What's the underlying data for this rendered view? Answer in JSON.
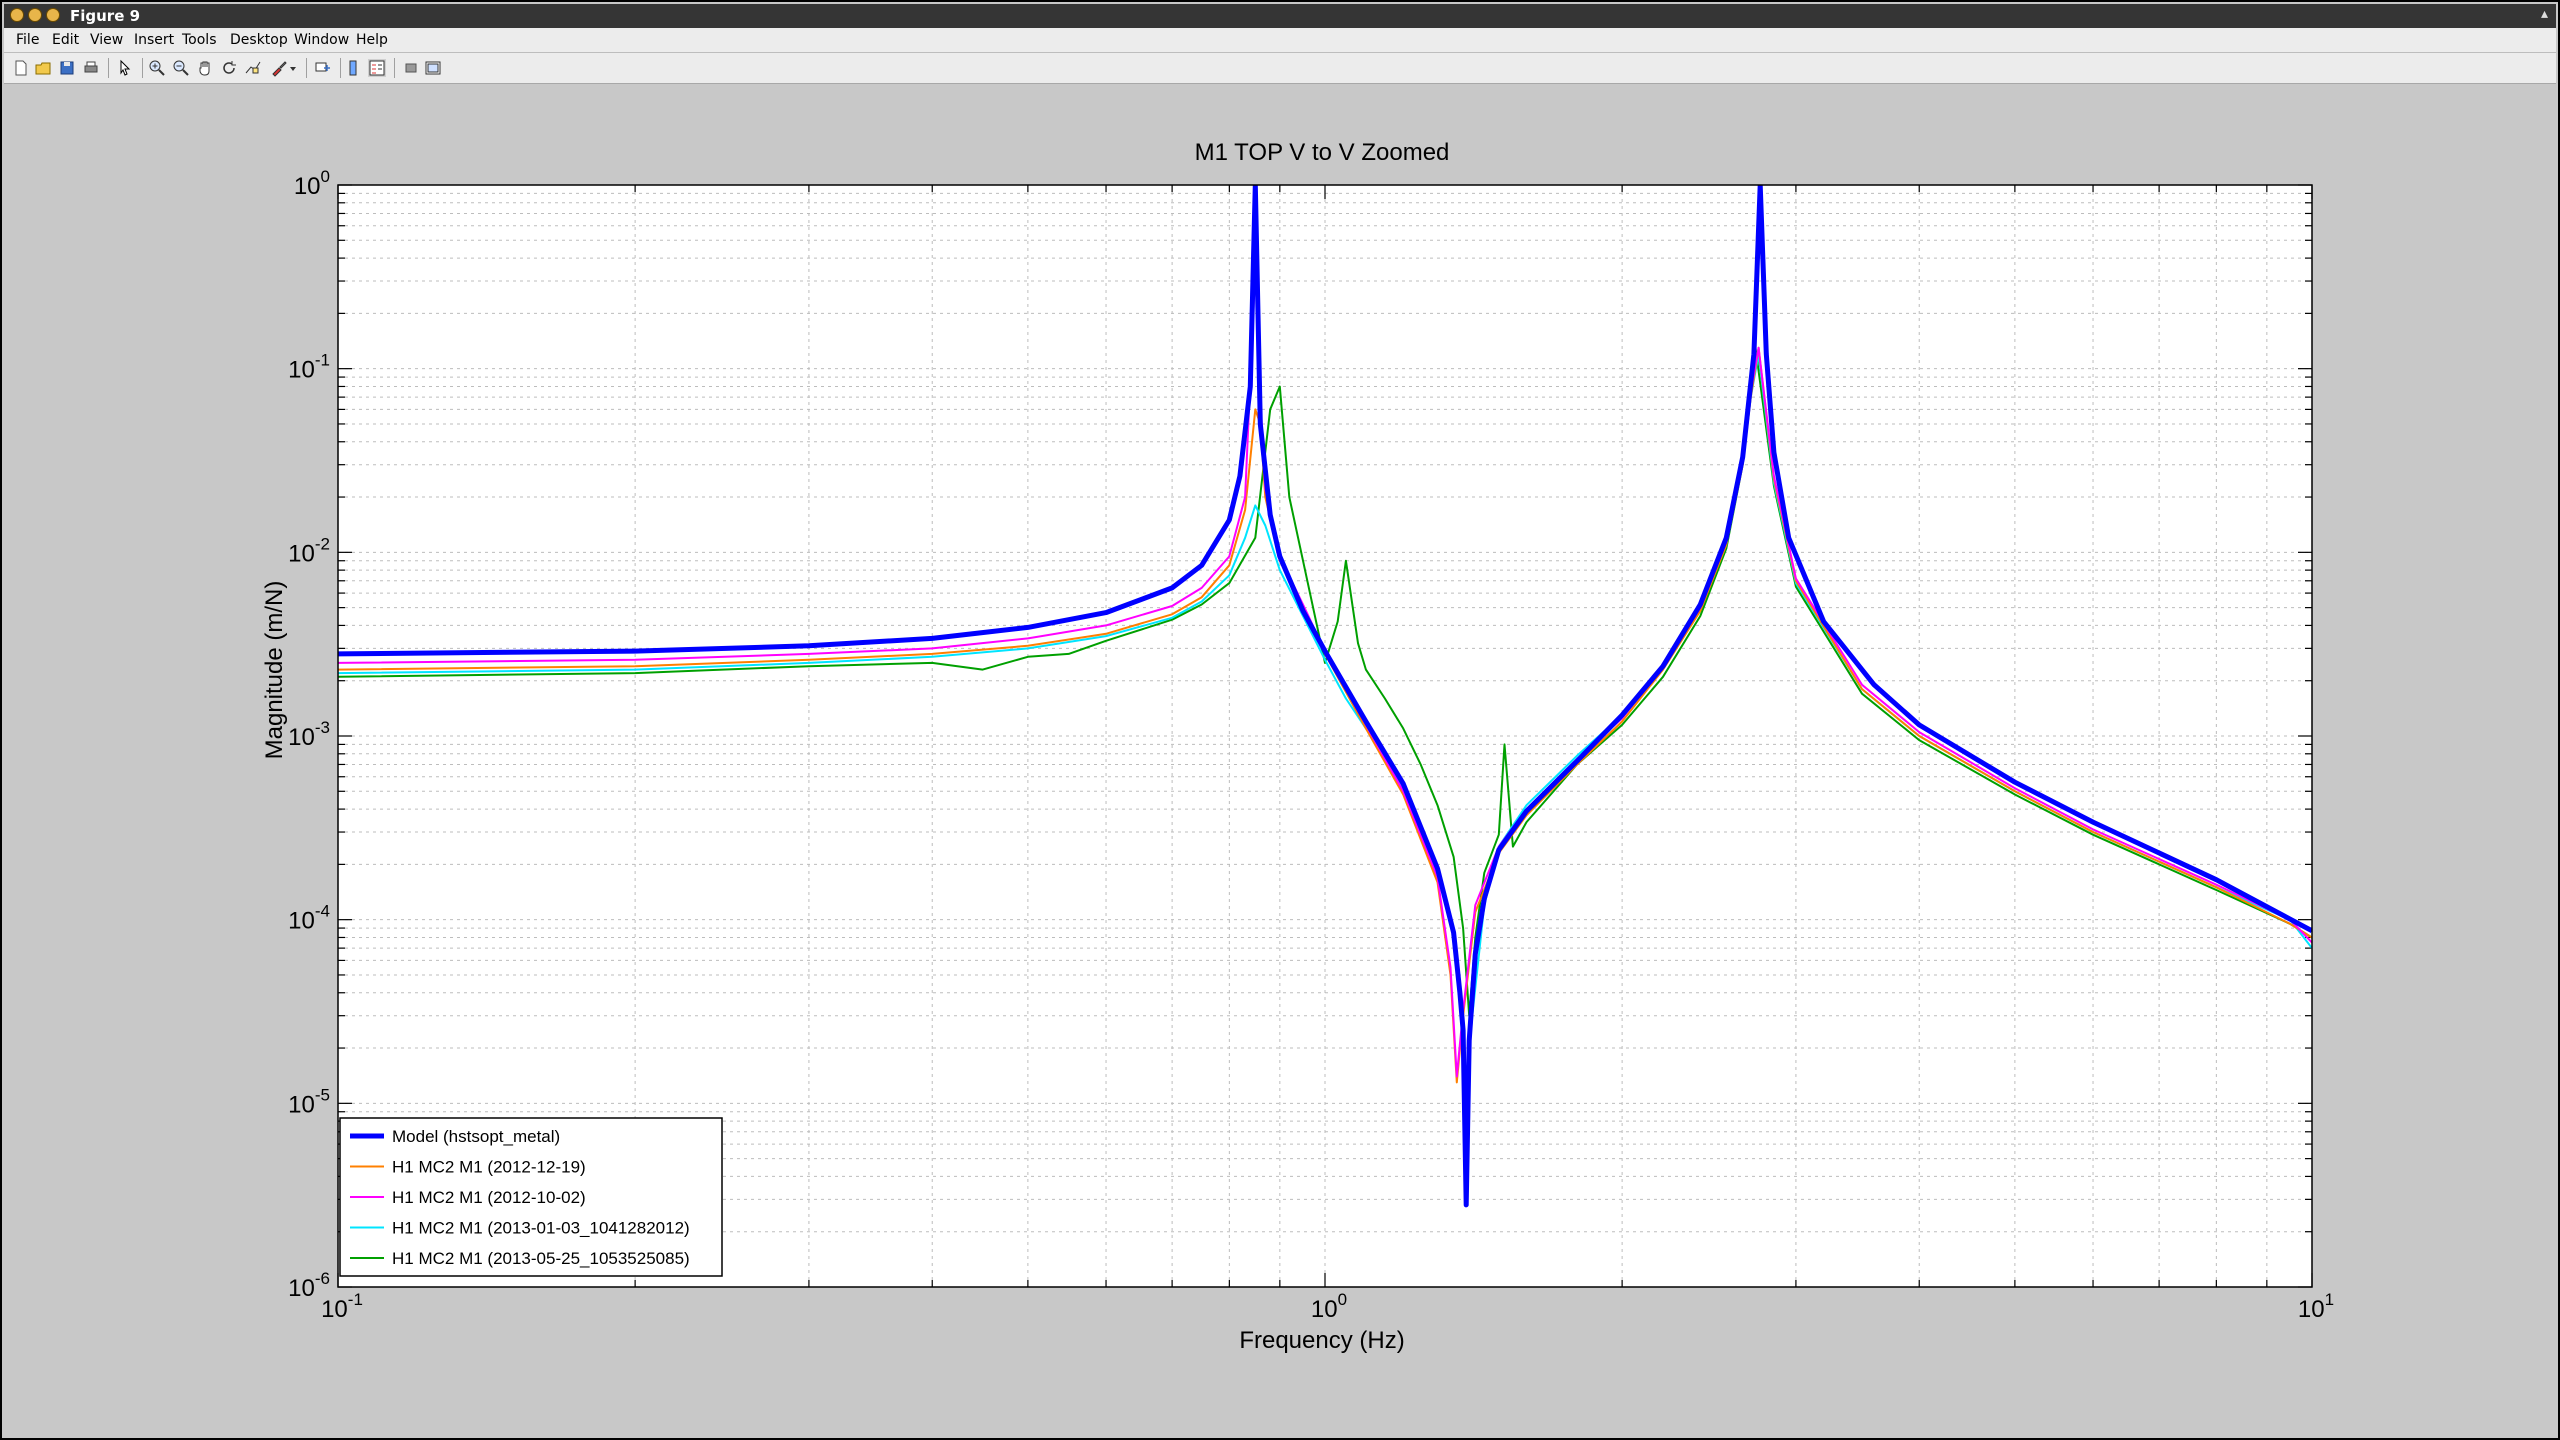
{
  "window": {
    "title": "Figure 9"
  },
  "menu": [
    "File",
    "Edit",
    "View",
    "Insert",
    "Tools",
    "Desktop",
    "Window",
    "Help"
  ],
  "toolbar": [
    "new-figure-icon",
    "open-file-icon",
    "save-icon",
    "print-icon",
    "edit-plot-arrow-icon",
    "zoom-in-icon",
    "zoom-out-icon",
    "pan-hand-icon",
    "rotate-3d-icon",
    "data-cursor-icon",
    "brush-icon",
    "brush-dropdown-icon",
    "link-plot-icon",
    "colorbar-icon",
    "legend-icon",
    "hide-plot-tools-icon",
    "show-plot-tools-icon"
  ],
  "chart_data": {
    "type": "line",
    "title": "M1 TOP V to V Zoomed",
    "xlabel": "Frequency (Hz)",
    "ylabel": "Magnitude (m/N)",
    "xscale": "log",
    "yscale": "log",
    "xlim": [
      0.1,
      10
    ],
    "ylim": [
      1e-06,
      1
    ],
    "grid": true,
    "legend_position": "bottom-left",
    "x_ticks": [
      {
        "base": "10",
        "exp": "-1"
      },
      {
        "base": "10",
        "exp": "0"
      },
      {
        "base": "10",
        "exp": "1"
      }
    ],
    "y_ticks": [
      {
        "base": "10",
        "exp": "-6"
      },
      {
        "base": "10",
        "exp": "-5"
      },
      {
        "base": "10",
        "exp": "-4"
      },
      {
        "base": "10",
        "exp": "-3"
      },
      {
        "base": "10",
        "exp": "-2"
      },
      {
        "base": "10",
        "exp": "-1"
      },
      {
        "base": "10",
        "exp": "0"
      }
    ],
    "series": [
      {
        "name": "Model (hstsopt_metal)",
        "color": "#0000ff",
        "x": [
          0.1,
          0.2,
          0.3,
          0.4,
          0.5,
          0.6,
          0.7,
          0.75,
          0.8,
          0.82,
          0.84,
          0.85,
          0.86,
          0.88,
          0.9,
          0.95,
          1.0,
          1.1,
          1.2,
          1.3,
          1.35,
          1.37,
          1.38,
          1.39,
          1.4,
          1.42,
          1.45,
          1.5,
          1.6,
          1.8,
          2.0,
          2.2,
          2.4,
          2.55,
          2.65,
          2.72,
          2.76,
          2.8,
          2.85,
          2.95,
          3.2,
          3.6,
          4.0,
          5.0,
          6.0,
          8.0,
          10.0
        ],
        "y": [
          0.0028,
          0.0029,
          0.0031,
          0.0034,
          0.0039,
          0.0047,
          0.0064,
          0.0085,
          0.015,
          0.026,
          0.08,
          1.0,
          0.05,
          0.016,
          0.0095,
          0.0048,
          0.0029,
          0.0012,
          0.00055,
          0.00019,
          8.5e-05,
          4e-05,
          2.5e-05,
          2.8e-06,
          2.2e-05,
          6.5e-05,
          0.00013,
          0.00024,
          0.00039,
          0.00073,
          0.0013,
          0.0024,
          0.0052,
          0.012,
          0.033,
          0.12,
          1.0,
          0.12,
          0.035,
          0.012,
          0.0042,
          0.0019,
          0.00115,
          0.00056,
          0.00034,
          0.000165,
          8.7e-05
        ]
      },
      {
        "name": "H1 MC2  M1 (2012-12-19)",
        "color": "#ff8000",
        "x": [
          0.1,
          0.2,
          0.3,
          0.4,
          0.5,
          0.6,
          0.7,
          0.75,
          0.8,
          0.83,
          0.85,
          0.86,
          0.87,
          0.9,
          0.95,
          1.0,
          1.1,
          1.2,
          1.3,
          1.34,
          1.36,
          1.38,
          1.42,
          1.5,
          1.6,
          1.8,
          2.0,
          2.2,
          2.4,
          2.55,
          2.65,
          2.7,
          2.75,
          2.85,
          3.0,
          3.5,
          4.0,
          5.0,
          6.0,
          8.0,
          9.5,
          10.0
        ],
        "y": [
          0.0023,
          0.0024,
          0.0026,
          0.0028,
          0.0031,
          0.0036,
          0.0046,
          0.0057,
          0.0085,
          0.017,
          0.06,
          0.05,
          0.02,
          0.009,
          0.005,
          0.0028,
          0.0011,
          0.00048,
          0.00016,
          5e-05,
          1.3e-05,
          3e-05,
          0.00011,
          0.00023,
          0.00037,
          0.0007,
          0.0012,
          0.0023,
          0.0048,
          0.011,
          0.03,
          0.07,
          0.13,
          0.025,
          0.007,
          0.0018,
          0.001,
          0.0005,
          0.0003,
          0.00015,
          9.5e-05,
          8e-05
        ]
      },
      {
        "name": "H1 MC2  M1 (2012-10-02)",
        "color": "#ff00ff",
        "x": [
          0.1,
          0.2,
          0.3,
          0.4,
          0.5,
          0.6,
          0.7,
          0.75,
          0.8,
          0.83,
          0.85,
          0.86,
          0.87,
          0.9,
          0.95,
          1.0,
          1.1,
          1.2,
          1.3,
          1.34,
          1.36,
          1.38,
          1.42,
          1.5,
          1.6,
          1.8,
          2.0,
          2.2,
          2.4,
          2.55,
          2.65,
          2.7,
          2.75,
          2.85,
          3.0,
          3.5,
          4.0,
          5.0,
          6.0,
          8.0,
          9.5,
          10.0
        ],
        "y": [
          0.0025,
          0.0026,
          0.0028,
          0.003,
          0.0034,
          0.004,
          0.0051,
          0.0064,
          0.0095,
          0.02,
          0.35,
          0.07,
          0.022,
          0.0095,
          0.0052,
          0.0029,
          0.00115,
          0.0005,
          0.00017,
          5.5e-05,
          1.4e-05,
          3.2e-05,
          0.00012,
          0.00025,
          0.0004,
          0.00075,
          0.00125,
          0.0024,
          0.005,
          0.0115,
          0.032,
          0.075,
          0.13,
          0.026,
          0.0072,
          0.0019,
          0.00105,
          0.00052,
          0.00031,
          0.000155,
          0.0001,
          7.5e-05
        ]
      },
      {
        "name": "H1 MC2  M1 (2013-01-03_1041282012)",
        "color": "#00e5ff",
        "x": [
          0.1,
          0.2,
          0.3,
          0.4,
          0.5,
          0.6,
          0.7,
          0.75,
          0.8,
          0.83,
          0.85,
          0.87,
          0.9,
          0.95,
          1.0,
          1.05,
          1.1,
          1.15,
          1.2,
          1.25,
          1.3,
          1.35,
          1.37,
          1.39,
          1.41,
          1.45,
          1.5,
          1.6,
          1.8,
          2.0,
          2.2,
          2.4,
          2.55,
          2.65,
          2.7,
          2.75,
          2.85,
          3.0,
          3.5,
          4.0,
          5.0,
          6.0,
          8.0,
          9.5,
          10.0
        ],
        "y": [
          0.0022,
          0.0023,
          0.0025,
          0.0027,
          0.003,
          0.0035,
          0.0044,
          0.0054,
          0.0075,
          0.012,
          0.018,
          0.014,
          0.008,
          0.0045,
          0.0026,
          0.0016,
          0.0011,
          0.0008,
          0.00052,
          0.0003,
          0.00018,
          9e-05,
          4e-05,
          1.2e-05,
          3e-05,
          0.00012,
          0.00025,
          0.00042,
          0.00078,
          0.0013,
          0.0024,
          0.0049,
          0.011,
          0.031,
          0.07,
          0.12,
          0.024,
          0.0068,
          0.0018,
          0.001,
          0.0005,
          0.0003,
          0.00015,
          0.0001,
          7e-05
        ]
      },
      {
        "name": "H1 MC2  M1 (2013-05-25_1053525085)",
        "color": "#00a000",
        "x": [
          0.1,
          0.2,
          0.3,
          0.4,
          0.45,
          0.5,
          0.55,
          0.6,
          0.7,
          0.75,
          0.8,
          0.85,
          0.88,
          0.9,
          0.92,
          0.95,
          1.0,
          1.03,
          1.05,
          1.08,
          1.1,
          1.15,
          1.2,
          1.25,
          1.3,
          1.35,
          1.38,
          1.4,
          1.42,
          1.45,
          1.5,
          1.52,
          1.55,
          1.6,
          1.8,
          2.0,
          2.2,
          2.4,
          2.55,
          2.65,
          2.7,
          2.73,
          2.85,
          3.0,
          3.5,
          4.0,
          5.0,
          6.0,
          8.0,
          9.5,
          10.0
        ],
        "y": [
          0.0021,
          0.0022,
          0.0024,
          0.0025,
          0.0023,
          0.0027,
          0.0028,
          0.0033,
          0.0043,
          0.0052,
          0.0068,
          0.012,
          0.06,
          0.08,
          0.02,
          0.009,
          0.0025,
          0.0042,
          0.009,
          0.0032,
          0.0023,
          0.0016,
          0.0011,
          0.0007,
          0.00042,
          0.00022,
          9e-05,
          3e-05,
          8e-05,
          0.00018,
          0.00029,
          0.0009,
          0.00025,
          0.00034,
          0.0007,
          0.00115,
          0.0021,
          0.0045,
          0.0105,
          0.03,
          0.08,
          0.13,
          0.023,
          0.0065,
          0.0017,
          0.00095,
          0.00048,
          0.00029,
          0.000145,
          9.5e-05,
          8e-05
        ]
      }
    ]
  }
}
